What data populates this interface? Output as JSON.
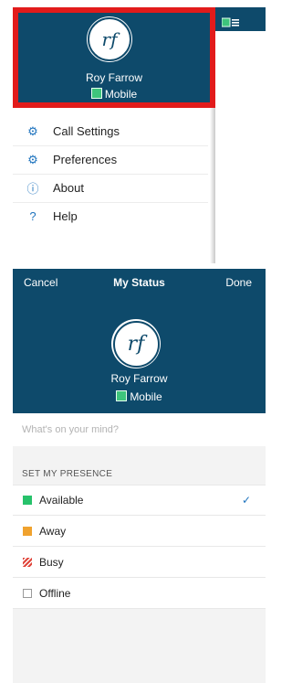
{
  "menu": {
    "user": {
      "initials": "rf",
      "name": "Roy Farrow",
      "status": "Mobile"
    },
    "items": [
      {
        "label": "Call Settings",
        "icon": "gear-icon"
      },
      {
        "label": "Preferences",
        "icon": "gears-icon"
      },
      {
        "label": "About",
        "icon": "info-icon"
      },
      {
        "label": "Help",
        "icon": "question-icon"
      }
    ]
  },
  "status_screen": {
    "nav": {
      "cancel": "Cancel",
      "title": "My Status",
      "done": "Done"
    },
    "user": {
      "initials": "rf",
      "name": "Roy Farrow",
      "status": "Mobile"
    },
    "mind_placeholder": "What's on your mind?",
    "presence_heading": "SET MY PRESENCE",
    "options": [
      {
        "label": "Available",
        "color": "#27c26b",
        "selected": true
      },
      {
        "label": "Away",
        "color": "#f0a22e",
        "selected": false
      },
      {
        "label": "Busy",
        "color": "#e0463c",
        "selected": false
      },
      {
        "label": "Offline",
        "color": "#ffffff",
        "selected": false
      }
    ],
    "check_glyph": "✓"
  },
  "colors": {
    "header_bg": "#0e4a6b",
    "highlight": "#e21b1b",
    "accent": "#1e73be"
  }
}
